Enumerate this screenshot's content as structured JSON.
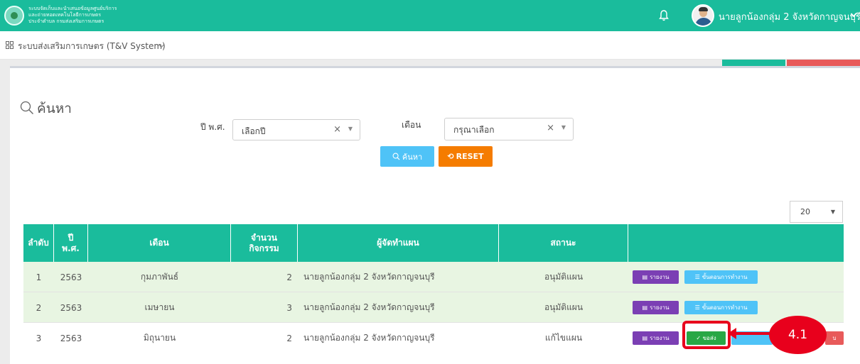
{
  "header": {
    "logo_lines": [
      "ระบบจัดเก็บและนำเสนอข้อมูลศูนย์บริการ",
      "และถ่ายทอดเทคโนโลยีการเกษตร",
      "ประจำตำบล กรมส่งเสริมการเกษตร"
    ],
    "user_name": "นายลูกน้องกลุ่ม 2 จังหวัดกาญจนบุรี",
    "bell_icon": "bell-icon",
    "chevron_icon": "chevron-down-icon"
  },
  "subbar": {
    "system_label": "ระบบส่งเสริมการเกษตร (T&V System)",
    "grid_icon": "grid-icon"
  },
  "search": {
    "title": "ค้นหา",
    "year_label": "ปี พ.ศ.",
    "year_value": "เลือกปี",
    "month_label": "เดือน",
    "month_value": "กรุณาเลือก",
    "clear_glyph": "×",
    "search_button": "ค้นหา",
    "reset_button": "RESET"
  },
  "pagination": {
    "page_size": "20"
  },
  "table": {
    "headers": {
      "index": "ลำดับ",
      "year_line1": "ปี",
      "year_line2": "พ.ศ.",
      "month": "เดือน",
      "count_line1": "จำนวน",
      "count_line2": "กิจกรรม",
      "planner": "ผู้จัดทำแผน",
      "status": "สถานะ",
      "actions": ""
    },
    "rows": [
      {
        "index": "1",
        "year": "2563",
        "month": "กุมภาพันธ์",
        "count": "2",
        "planner": "นายลูกน้องกลุ่ม 2 จังหวัดกาญจนบุรี",
        "status": "อนุมัติแผน"
      },
      {
        "index": "2",
        "year": "2563",
        "month": "เมษายน",
        "count": "3",
        "planner": "นายลูกน้องกลุ่ม 2 จังหวัดกาญจนบุรี",
        "status": "อนุมัติแผน"
      },
      {
        "index": "3",
        "year": "2563",
        "month": "มิถุนายน",
        "count": "2",
        "planner": "นายลูกน้องกลุ่ม 2 จังหวัดกาญจนบุรี",
        "status": "แก้ไขแผน"
      }
    ],
    "actions": {
      "report": "รายงาน",
      "steps": "ขั้นตอนการทำงาน",
      "send": "✓ ขอส่ง",
      "partial_red": "บ"
    }
  },
  "annotation": {
    "label": "4.1"
  },
  "colors": {
    "teal": "#1abc9c",
    "purple": "#7b3fb4",
    "sky": "#4fc3f7",
    "orange": "#f57c00",
    "green": "#28a745",
    "red": "#e8001c"
  }
}
